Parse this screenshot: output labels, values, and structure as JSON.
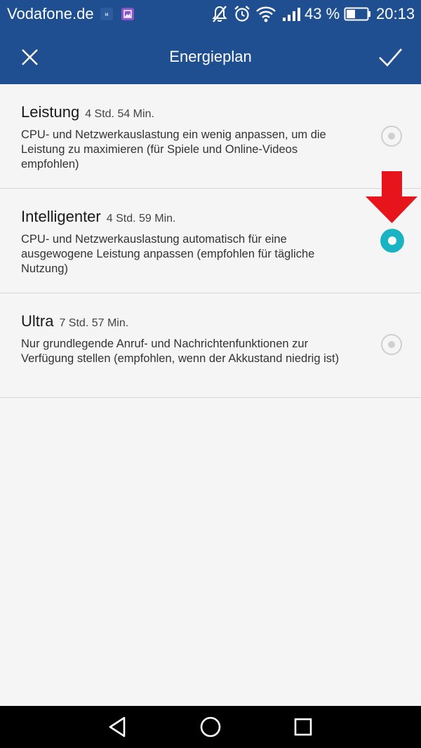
{
  "status_bar": {
    "carrier": "Vodafone.de",
    "battery_percent": "43 %",
    "battery_level": 0.43,
    "time": "20:13",
    "icons": [
      "message-icon",
      "gallery-icon",
      "silent-icon",
      "alarm-icon",
      "wifi-icon",
      "signal-icon",
      "battery-icon"
    ]
  },
  "app_bar": {
    "title": "Energieplan",
    "close_icon": "close-icon",
    "confirm_icon": "check-icon",
    "color": "#1f4f91"
  },
  "plans": [
    {
      "name": "Leistung",
      "time": "4 Std. 54 Min.",
      "description": "CPU- und Netzwerkauslastung ein wenig anpassen, um die Leistung zu maximieren (für Spiele und Online-Videos empfohlen)",
      "selected": false
    },
    {
      "name": "Intelligenter",
      "time": "4 Std. 59 Min.",
      "description": "CPU- und Netzwerkauslastung automatisch für eine ausgewogene Leistung anpassen (empfohlen für tägliche Nutzung)",
      "selected": true
    },
    {
      "name": "Ultra",
      "time": "7 Std. 57 Min.",
      "description": "Nur grundlegende Anruf- und Nachrichtenfunktionen zur Verfügung stellen (empfohlen, wenn der Akkustand niedrig ist)",
      "selected": false
    }
  ],
  "colors": {
    "accent": "#19b4c4",
    "annotation_arrow": "#e8141c"
  },
  "nav_bar": {
    "icons": [
      "back-icon",
      "home-icon",
      "recent-apps-icon"
    ]
  }
}
